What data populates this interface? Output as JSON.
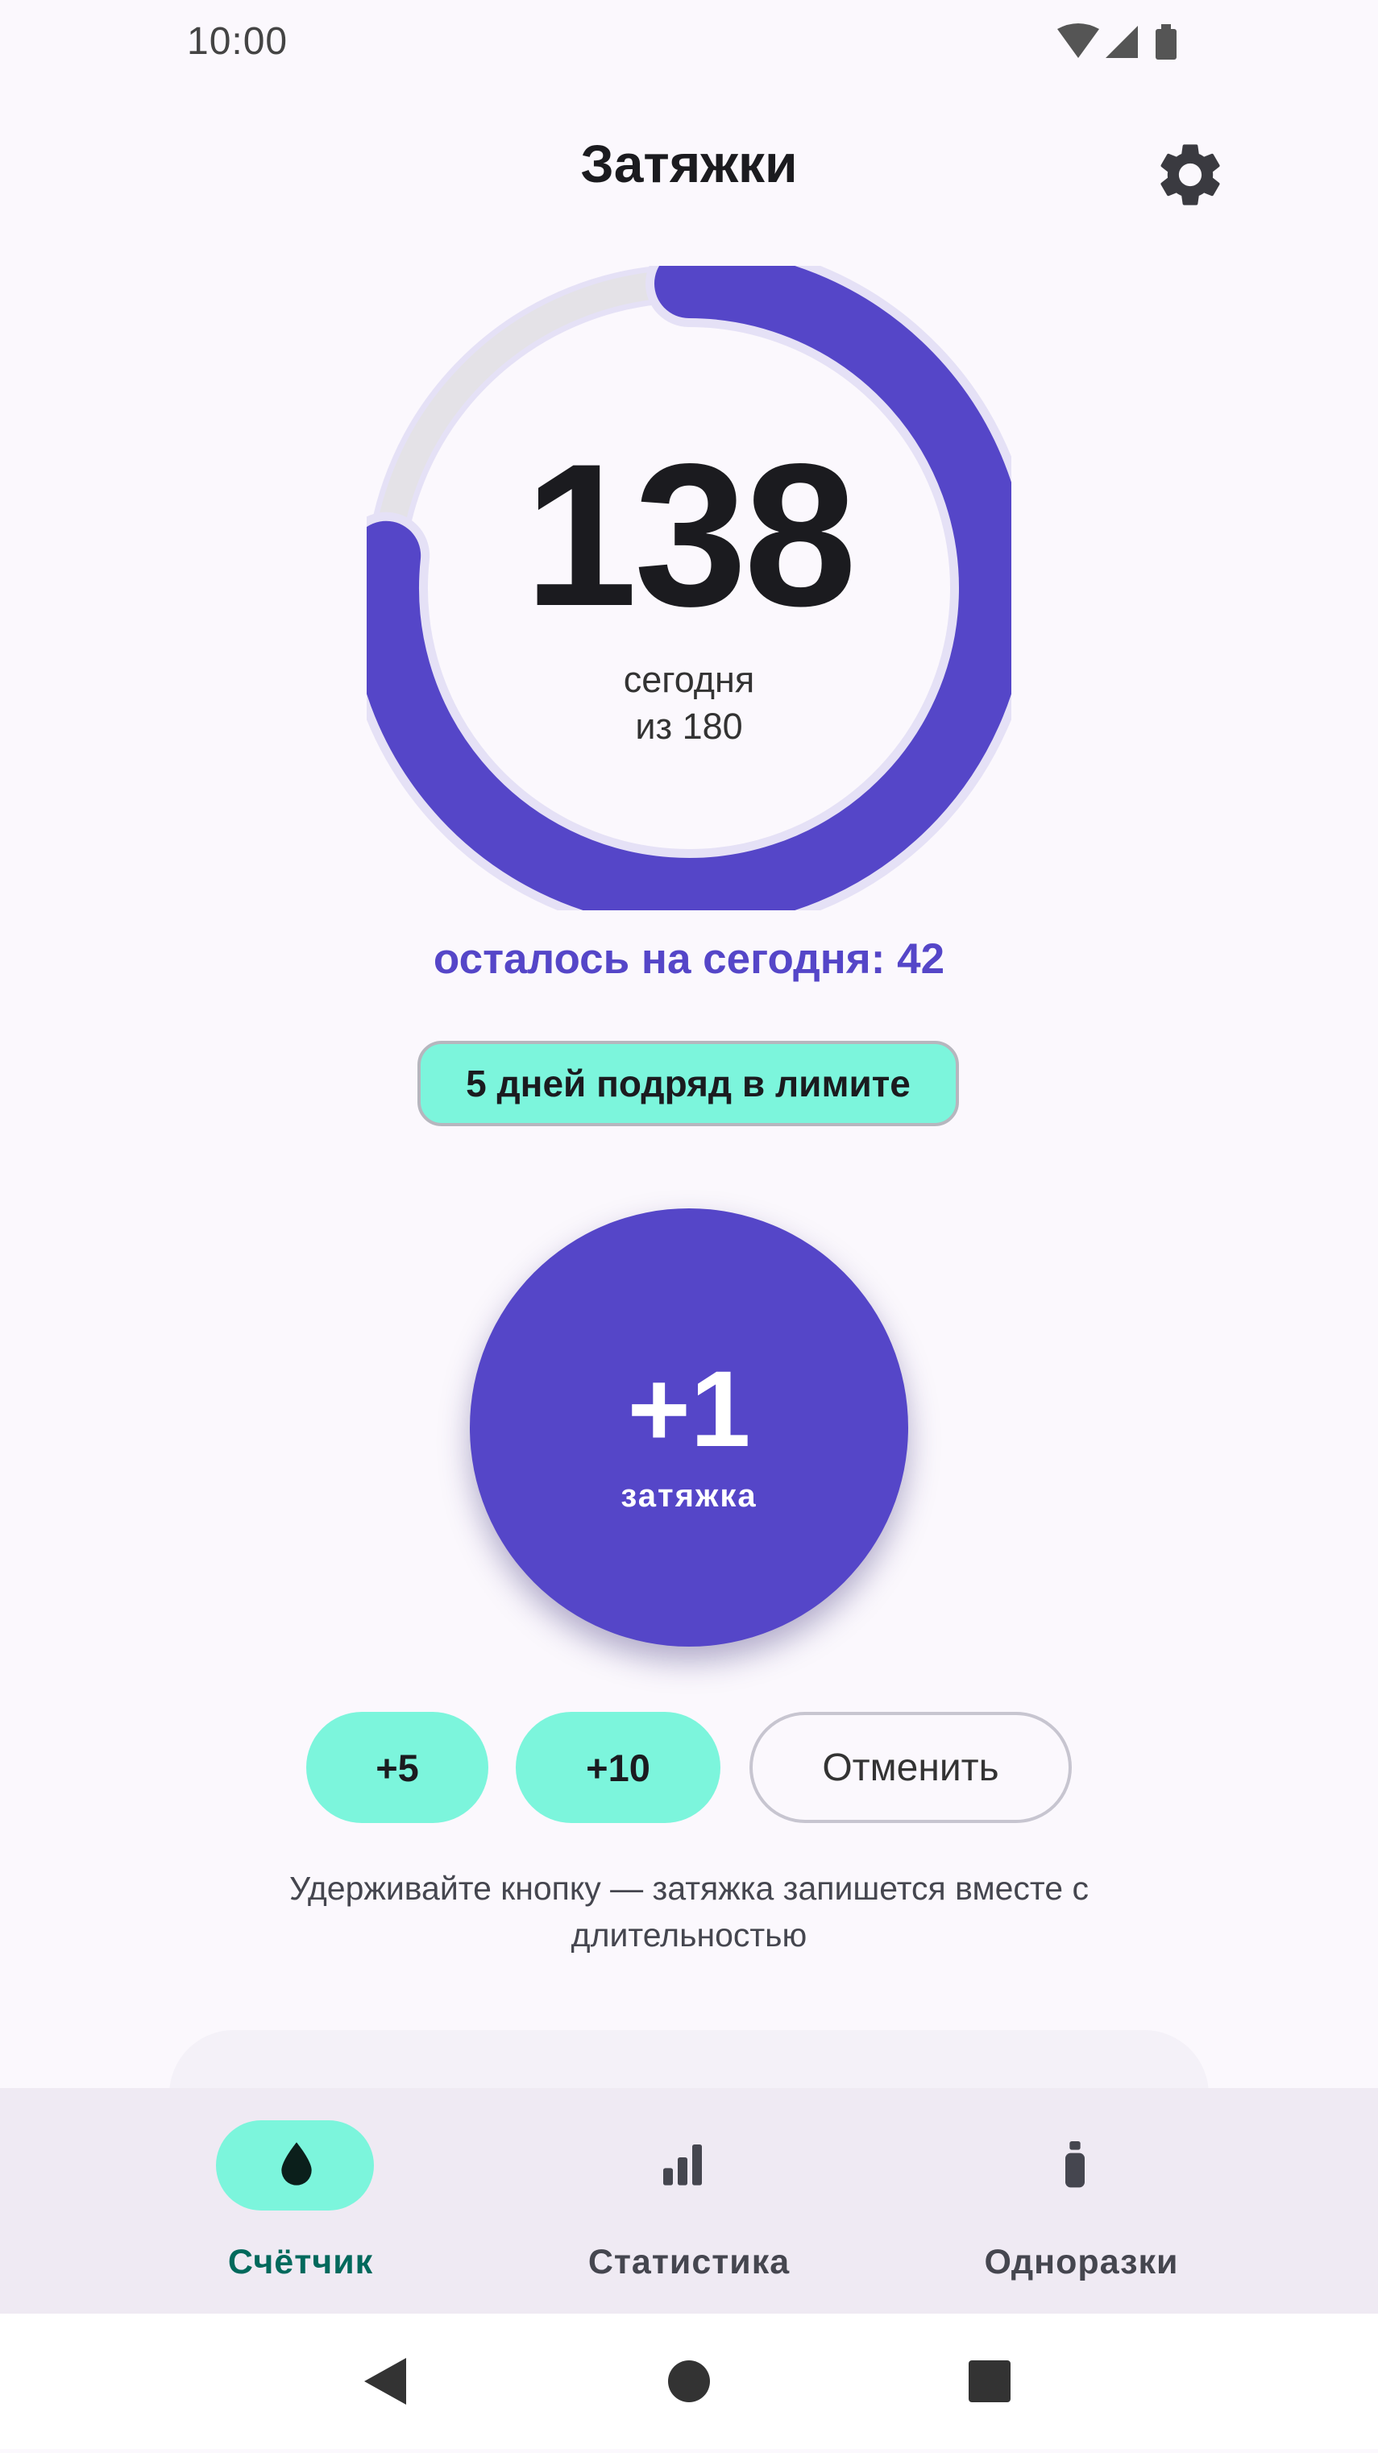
{
  "status_bar": {
    "time": "10:00",
    "icons": [
      "wifi-icon",
      "signal-icon",
      "battery-icon"
    ]
  },
  "header": {
    "title": "Затяжки",
    "settings_icon": "gear-icon"
  },
  "counter": {
    "value": "138",
    "today_label": "сегодня",
    "limit_label": "из 180",
    "limit": 180,
    "count": 138,
    "progress_fraction": 0.767,
    "remaining_text": "осталось на сегодня: 42"
  },
  "streak": {
    "label": "5 дней подряд в лимите"
  },
  "main_button": {
    "label": "+1",
    "sublabel": "затяжка"
  },
  "quick_actions": {
    "plus5": "+5",
    "plus10": "+10",
    "undo": "Отменить"
  },
  "hint": "Удерживайте кнопку — затяжка запишется вместе с длительностью",
  "bottom_nav": {
    "items": [
      {
        "label": "Счётчик",
        "icon": "drop-icon",
        "selected": true
      },
      {
        "label": "Статистика",
        "icon": "bar-chart-icon",
        "selected": false
      },
      {
        "label": "Одноразки",
        "icon": "vape-icon",
        "selected": false
      }
    ]
  },
  "colors": {
    "accent": "#5546C8",
    "accent_light": "#E5E1F6",
    "track": "#E4E2E7",
    "mint": "#7CF5DC",
    "background": "#FBF8FD",
    "nav_background": "#EFEAF3",
    "selected_label": "#00695C"
  }
}
